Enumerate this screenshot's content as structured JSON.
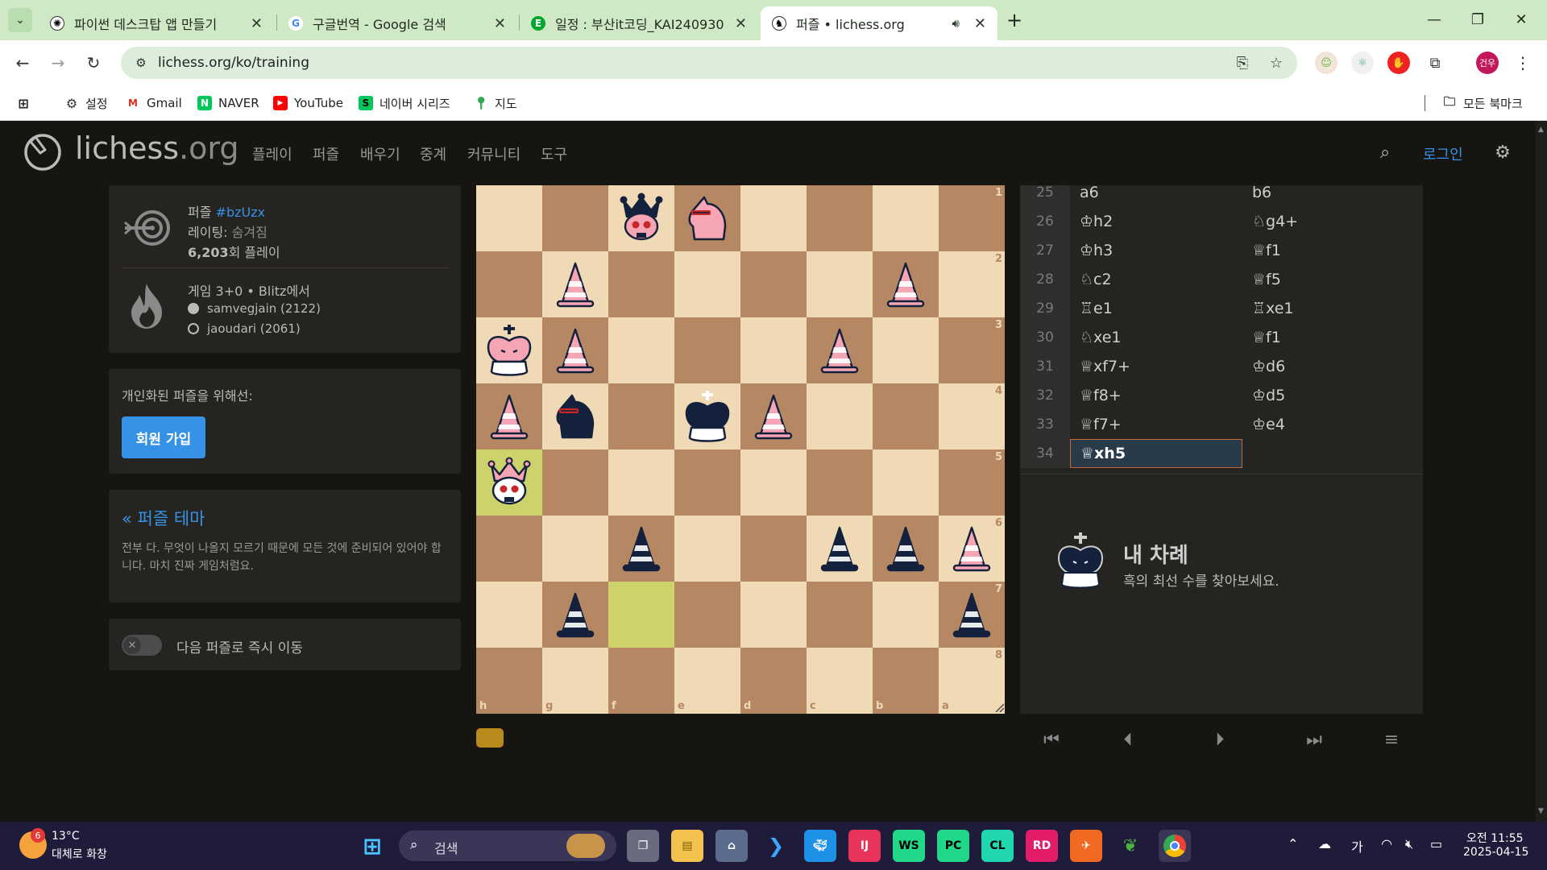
{
  "browser": {
    "tabs": [
      {
        "title": "파이썬 데스크탑 앱 만들기",
        "favicon": "chatgpt-icon"
      },
      {
        "title": "구글번역 - Google 검색",
        "favicon": "google-icon"
      },
      {
        "title": "일정 : 부산it코딩_KAI240930 |",
        "favicon": "evernote-icon"
      },
      {
        "title": "퍼즐 • lichess.org",
        "favicon": "lichess-icon",
        "active": true
      }
    ],
    "url": "lichess.org/ko/training",
    "bookmarks": [
      {
        "label": "설정",
        "icon": "gear-icon"
      },
      {
        "label": "Gmail",
        "icon": "gmail-icon"
      },
      {
        "label": "NAVER",
        "icon": "naver-icon"
      },
      {
        "label": "YouTube",
        "icon": "youtube-icon"
      },
      {
        "label": "네이버 시리즈",
        "icon": "naver-series-icon"
      },
      {
        "label": "지도",
        "icon": "maps-icon"
      }
    ],
    "all_bookmarks": "모든 북마크",
    "profile_initials": "건우"
  },
  "site": {
    "logo": {
      "name": "lichess",
      "tld": ".org"
    },
    "menu": [
      "플레이",
      "퍼즐",
      "배우기",
      "중계",
      "커뮤니티",
      "도구"
    ],
    "login": "로그인"
  },
  "puzzle": {
    "label": "퍼즐",
    "id": "#bzUzx",
    "rating_label": "레이팅:",
    "rating_value": "숨겨짐",
    "plays_count": "6,203",
    "plays_suffix": "회 플레이",
    "game_info": "게임 3+0 • Blitz에서",
    "players": [
      {
        "name": "samvegjain (2122)",
        "color": "white"
      },
      {
        "name": "jaoudari (2061)",
        "color": "black"
      }
    ]
  },
  "signup": {
    "prompt": "개인화된 퍼즐을 위해선:",
    "button": "회원 가입"
  },
  "theme": {
    "title": "« 퍼즐 테마",
    "desc": "전부 다. 무엇이 나올지 모르기 때문에 모든 것에 준비되어 있어야 합니다. 마치 진짜 게임처럼요."
  },
  "auto_next": {
    "label": "다음 퍼즐로 즉시 이동",
    "enabled": false
  },
  "board": {
    "orientation": "black",
    "ranks": [
      "1",
      "2",
      "3",
      "4",
      "5",
      "6",
      "7",
      "8"
    ],
    "files": [
      "h",
      "g",
      "f",
      "e",
      "d",
      "c",
      "b",
      "a"
    ],
    "rows": [
      [
        "",
        "",
        "bQ",
        "wN",
        "",
        "",
        "",
        ""
      ],
      [
        "",
        "wP",
        "",
        "",
        "",
        "",
        "wP",
        ""
      ],
      [
        "wK",
        "wP",
        "",
        "",
        "",
        "wP",
        "",
        ""
      ],
      [
        "wP",
        "bN",
        "",
        "bK",
        "wP",
        "",
        "",
        ""
      ],
      [
        "wQ",
        "",
        "",
        "",
        "",
        "",
        "",
        ""
      ],
      [
        "",
        "",
        "bP",
        "",
        "",
        "bP",
        "bP",
        "wP"
      ],
      [
        "",
        "bP",
        "",
        "",
        "",
        "",
        "",
        "bP"
      ],
      [
        "",
        "",
        "",
        "",
        "",
        "",
        "",
        ""
      ]
    ],
    "highlights": [
      "h5",
      "f7"
    ]
  },
  "moves": [
    {
      "n": "25",
      "w": "a6",
      "b": "b6"
    },
    {
      "n": "26",
      "w": "♔h2",
      "b": "♘g4+"
    },
    {
      "n": "27",
      "w": "♔h3",
      "b": "♕f1"
    },
    {
      "n": "28",
      "w": "♘c2",
      "b": "♕f5"
    },
    {
      "n": "29",
      "w": "♖e1",
      "b": "♖xe1"
    },
    {
      "n": "30",
      "w": "♘xe1",
      "b": "♕f1"
    },
    {
      "n": "31",
      "w": "♕xf7+",
      "b": "♔d6"
    },
    {
      "n": "32",
      "w": "♕f8+",
      "b": "♔d5"
    },
    {
      "n": "33",
      "w": "♕f7+",
      "b": "♔e4"
    },
    {
      "n": "34",
      "w": "♕xh5",
      "b": ""
    }
  ],
  "turn": {
    "title": "내 차례",
    "subtitle": "흑의 최선 수를 찾아보세요."
  },
  "taskbar": {
    "weather_temp": "13°C",
    "weather_desc": "대체로 화창",
    "weather_badge": "6",
    "search_placeholder": "검색",
    "ime": "가",
    "time": "오전 11:55",
    "date": "2025-04-15"
  },
  "colors": {
    "accent": "#3692e7",
    "board_light": "#f0d9b5",
    "board_dark": "#b58863",
    "highlight": "#ced26b",
    "white_piece": "#f6a5b4",
    "black_piece": "#14213d"
  }
}
